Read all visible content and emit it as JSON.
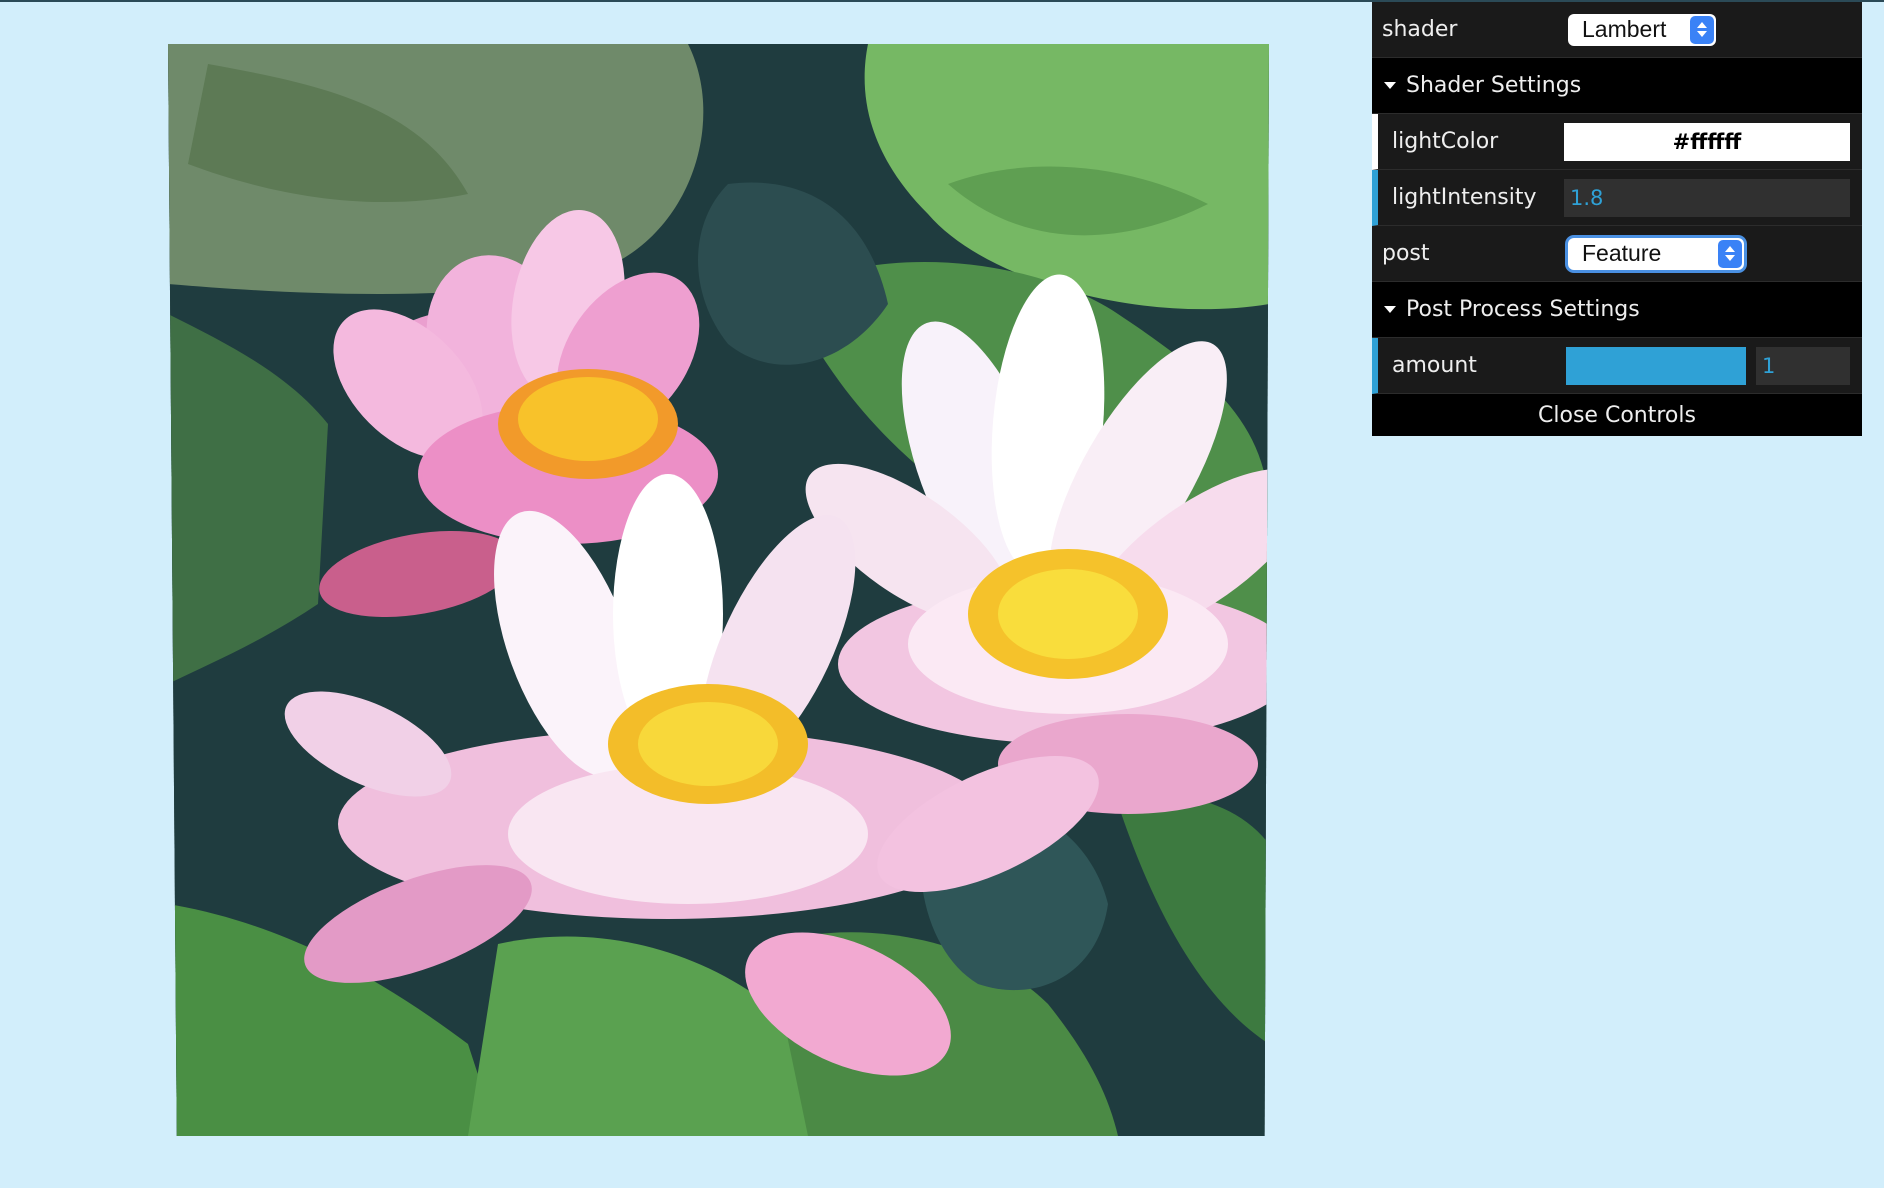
{
  "gui": {
    "shader": {
      "label": "shader",
      "value": "Lambert"
    },
    "shader_settings": {
      "title": "Shader Settings",
      "light_color": {
        "label": "lightColor",
        "value": "#ffffff"
      },
      "light_intensity": {
        "label": "lightIntensity",
        "value": "1.8"
      }
    },
    "post": {
      "label": "post",
      "value": "Feature"
    },
    "post_settings": {
      "title": "Post Process Settings",
      "amount": {
        "label": "amount",
        "value": "1",
        "fraction": 1.0
      }
    },
    "close_label": "Close Controls"
  },
  "colors": {
    "background": "#d2eefb",
    "panel": "#1a1a1a",
    "accent": "#2fa1d6"
  }
}
